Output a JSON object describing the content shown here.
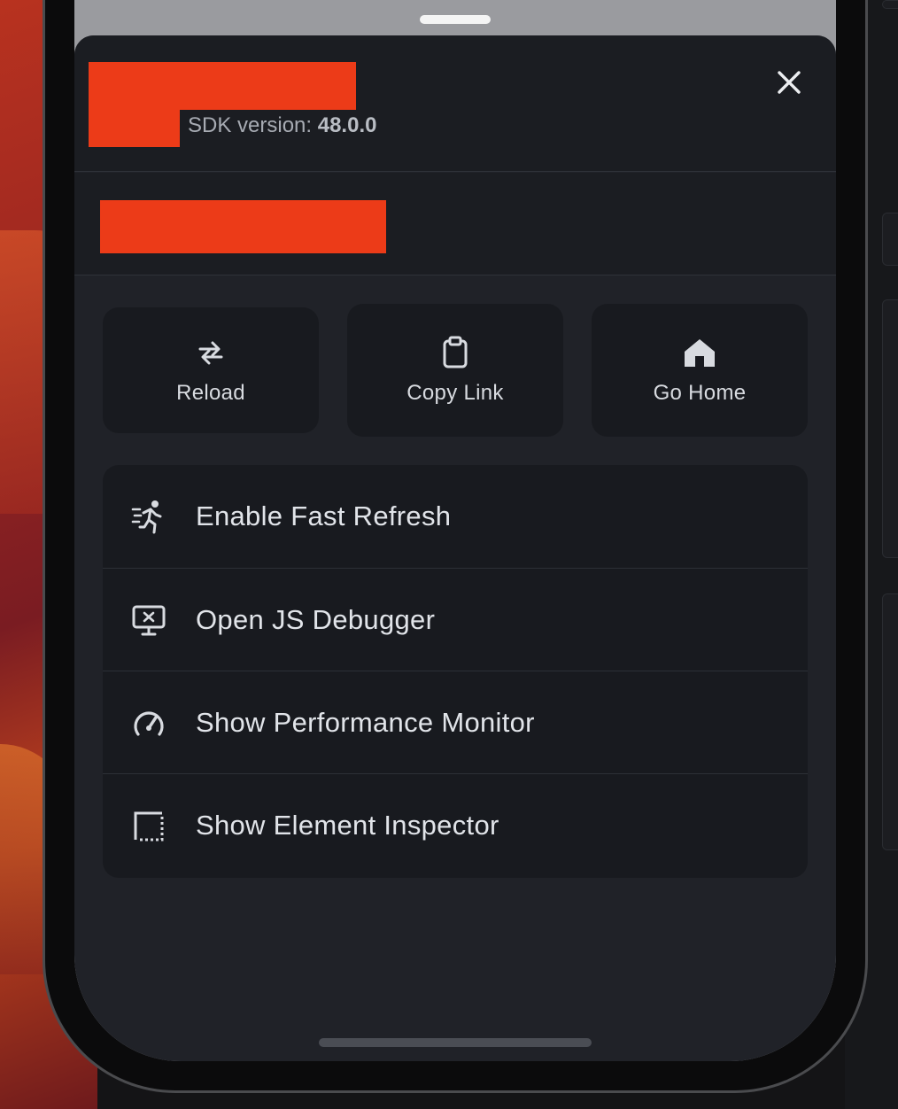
{
  "header": {
    "sdk_label": "SDK version:",
    "sdk_version": "48.0.0"
  },
  "actions": [
    {
      "label": "Reload",
      "icon": "reload-icon"
    },
    {
      "label": "Copy Link",
      "icon": "clipboard-icon"
    },
    {
      "label": "Go Home",
      "icon": "home-icon"
    }
  ],
  "menu": {
    "items": [
      {
        "label": "Enable Fast Refresh",
        "icon": "running-person-icon"
      },
      {
        "label": "Open JS Debugger",
        "icon": "debugger-monitor-icon"
      },
      {
        "label": "Show Performance Monitor",
        "icon": "speedometer-icon"
      },
      {
        "label": "Show Element Inspector",
        "icon": "inspector-frame-icon"
      }
    ]
  },
  "colors": {
    "sheet_bg": "#202228",
    "button_bg": "#181a1f",
    "redaction": "#ec3b18",
    "text": "#e1e4e9"
  }
}
